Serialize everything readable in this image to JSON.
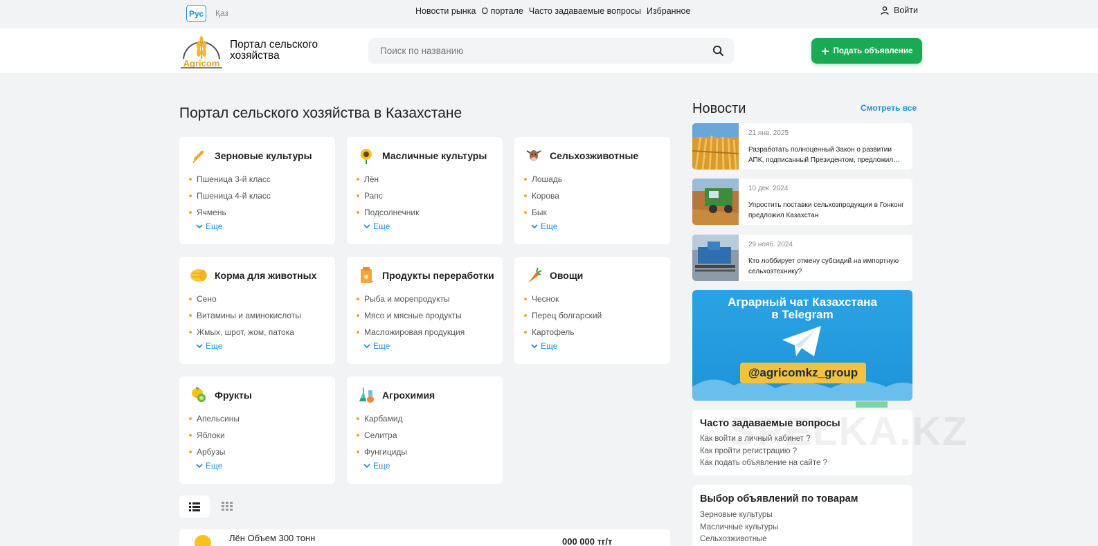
{
  "topbar": {
    "lang_ru": "Рус",
    "lang_kz": "Қаз",
    "nav": [
      "Новости рынка",
      "О портале",
      "Часто задаваемые вопросы",
      "Избранное"
    ],
    "login": "Войти"
  },
  "header": {
    "logo_text": "Agricom",
    "brand_line1": "Портал сельского",
    "brand_line2": "хозяйства",
    "search_placeholder": "Поиск по названию",
    "post_button": "Подать объявление"
  },
  "main": {
    "title": "Портал сельского хозяйства в Казахстане",
    "more_label": "Еще",
    "categories": [
      {
        "title": "Зерновые культуры",
        "icon": "wheat-icon",
        "items": [
          "Пшеница 3-й класс",
          "Пшеница 4-й класс",
          "Ячмень"
        ]
      },
      {
        "title": "Масличные культуры",
        "icon": "sunflower-icon",
        "items": [
          "Лён",
          "Рапс",
          "Подсолнечник"
        ]
      },
      {
        "title": "Сельхозживотные",
        "icon": "cow-icon",
        "items": [
          "Лошадь",
          "Корова",
          "Бык"
        ]
      },
      {
        "title": "Корма для животных",
        "icon": "hay-icon",
        "items": [
          "Сено",
          "Витамины и аминокислоты",
          "Жмых, шрот, жом, патока"
        ]
      },
      {
        "title": "Продукты переработки",
        "icon": "package-icon",
        "items": [
          "Рыба и морепродукты",
          "Мясо и мясные продукты",
          "Масложировая продукция"
        ]
      },
      {
        "title": "Овощи",
        "icon": "carrot-icon",
        "items": [
          "Чеснок",
          "Перец болгарский",
          "Картофель"
        ]
      },
      {
        "title": "Фрукты",
        "icon": "fruits-icon",
        "items": [
          "Апельсины",
          "Яблоки",
          "Арбузы"
        ]
      },
      {
        "title": "Агрохимия",
        "icon": "flask-icon",
        "items": [
          "Карбамид",
          "Селитра",
          "Фунгициды"
        ]
      }
    ],
    "listing": {
      "title": "Лён Объем 300 тонн",
      "price": "000 000 тг/т"
    }
  },
  "news": {
    "title": "Новости",
    "see_all": "Смотреть все",
    "items": [
      {
        "date": "21 янв. 2025",
        "text": "Разработать полноценный Закон о развитии АПК, подписанный Президентом, предложил…"
      },
      {
        "date": "10 дек. 2024",
        "text": "Упростить поставки сельхозпродукции в Гонконг предложил Казахстан"
      },
      {
        "date": "29 нояб. 2024",
        "text": "Кто лоббирует отмену субсидий на импортную сельхозтехнику?"
      }
    ]
  },
  "telegram": {
    "line1": "Аграрный чат Казахстана",
    "line2": "в Telegram",
    "handle": "@agricomkz_group"
  },
  "faq": {
    "title": "Часто задаваемые вопросы",
    "items": [
      "Как войти в личный кабинет ?",
      "Как пройти регистрацию ?",
      "Как подать объявление на сайте ?"
    ]
  },
  "ads": {
    "title": "Выбор объявлений по товарам",
    "items": [
      "Зерновые культуры",
      "Масличные культуры",
      "Сельхозживотные"
    ]
  },
  "watermark": "SPELKA.KZ",
  "colors": {
    "accent": "#1f8fd6",
    "brand_green": "#1aaa55",
    "bullet": "#f5a623",
    "background": "#f2f3f5"
  }
}
